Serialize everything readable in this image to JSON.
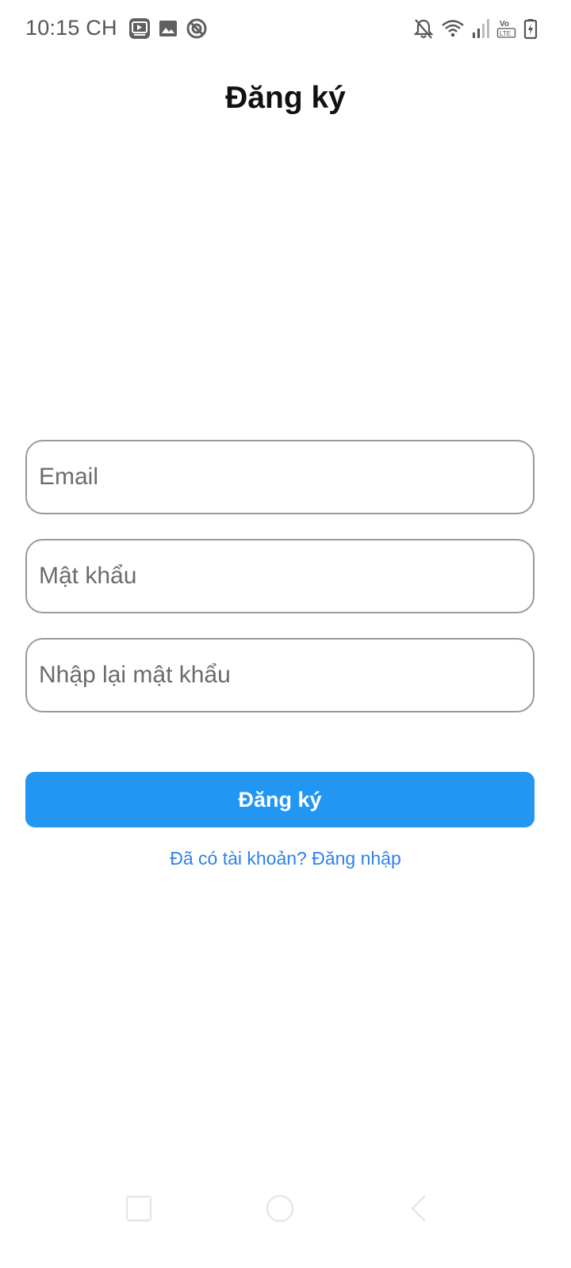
{
  "status_bar": {
    "time": "10:15 CH",
    "left_icons": [
      "video-app-icon",
      "image-icon",
      "sync-icon"
    ],
    "right_icons": [
      "bell-off-icon",
      "wifi-icon",
      "signal-icon",
      "volte-icon",
      "battery-charging-icon"
    ],
    "volte_label_top": "Vo",
    "volte_label_bottom": "LTE"
  },
  "header": {
    "title": "Đăng ký"
  },
  "form": {
    "email_placeholder": "Email",
    "password_placeholder": "Mật khẩu",
    "confirm_password_placeholder": "Nhập lại mật khẩu",
    "submit_label": "Đăng ký",
    "login_link": "Đã có tài khoản? Đăng nhập"
  },
  "nav_bar": {
    "buttons": [
      "recents-icon",
      "home-icon",
      "back-icon"
    ]
  },
  "colors": {
    "accent": "#2196f3",
    "link": "#2f80ed",
    "field_border": "#9a9a9a",
    "placeholder": "#6b6b6b"
  }
}
